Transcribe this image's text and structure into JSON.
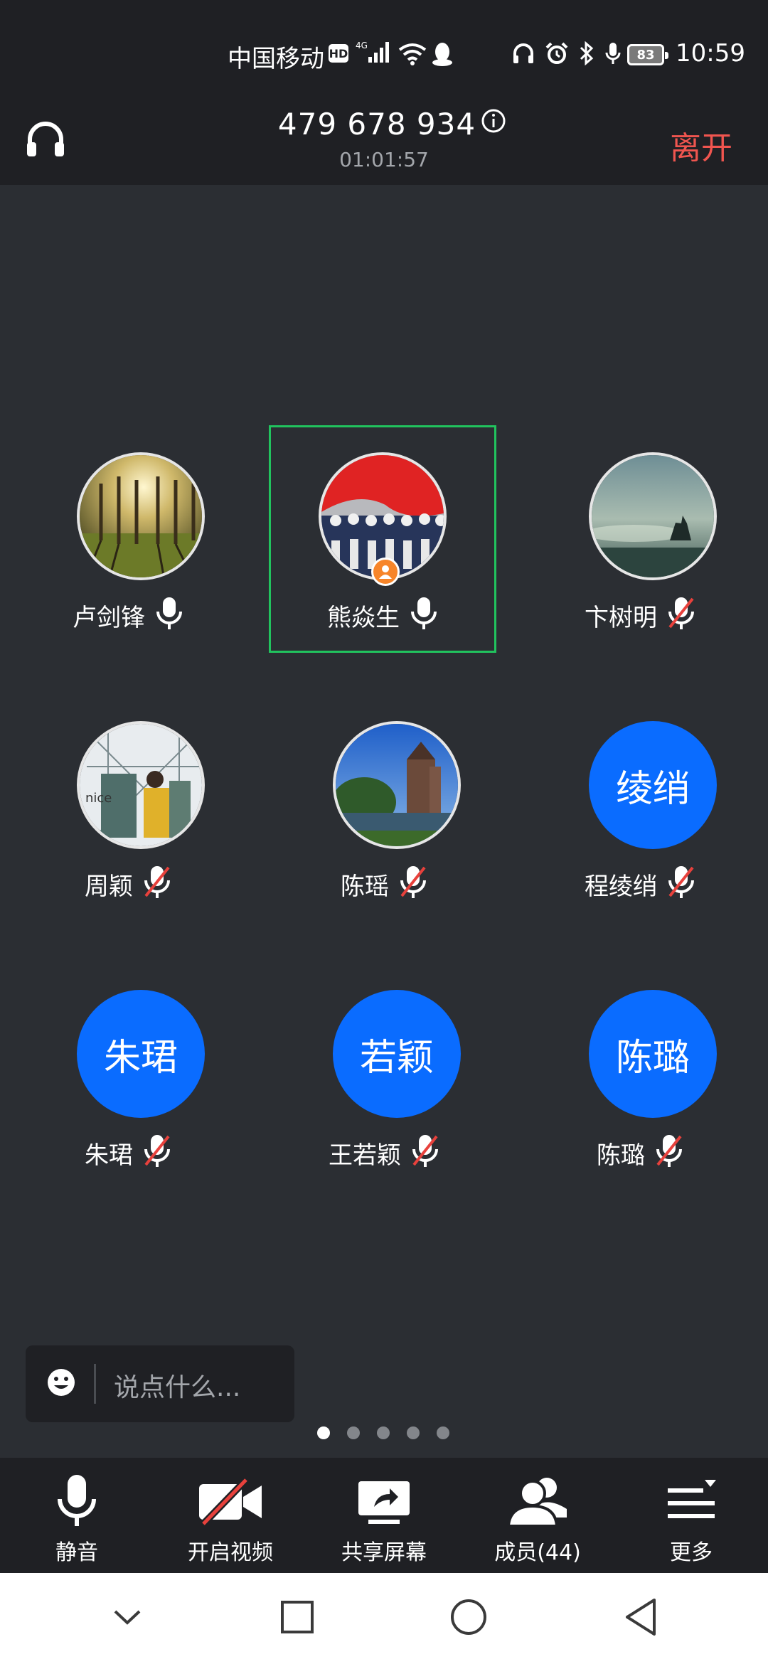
{
  "status_bar": {
    "carrier": "中国移动",
    "hd_badge": "HD",
    "network": "4G",
    "battery": "83",
    "time": "10:59"
  },
  "header": {
    "meeting_id": "479 678 934",
    "elapsed": "01:01:57",
    "leave_label": "离开"
  },
  "participants": [
    {
      "name": "卢剑锋",
      "mic": "on",
      "avatar": "photo-trees"
    },
    {
      "name": "熊焱生",
      "mic": "on",
      "avatar": "photo-parade",
      "host": true,
      "speaking": true
    },
    {
      "name": "卞树明",
      "mic": "muted",
      "avatar": "photo-horse"
    },
    {
      "name": "周颖",
      "mic": "muted",
      "avatar": "photo-girl"
    },
    {
      "name": "陈瑶",
      "mic": "muted",
      "avatar": "photo-castle"
    },
    {
      "name": "程绫绡",
      "mic": "muted",
      "avatar_text": "绫绡"
    },
    {
      "name": "朱珺",
      "mic": "muted",
      "avatar_text": "朱珺"
    },
    {
      "name": "王若颖",
      "mic": "muted",
      "avatar_text": "若颖"
    },
    {
      "name": "陈璐",
      "mic": "muted",
      "avatar_text": "陈璐"
    }
  ],
  "chat": {
    "placeholder": "说点什么..."
  },
  "pager": {
    "count": 5,
    "active": 0
  },
  "toolbar": {
    "mute": "静音",
    "video": "开启视频",
    "share": "共享屏幕",
    "members": "成员(44)",
    "more": "更多"
  },
  "colors": {
    "background": "#2b2e33",
    "bar": "#1f2024",
    "accent_blue": "#0a6cff",
    "leave_red": "#f0554f",
    "speaking_border": "#21c35e",
    "host_badge": "#f7852a"
  }
}
